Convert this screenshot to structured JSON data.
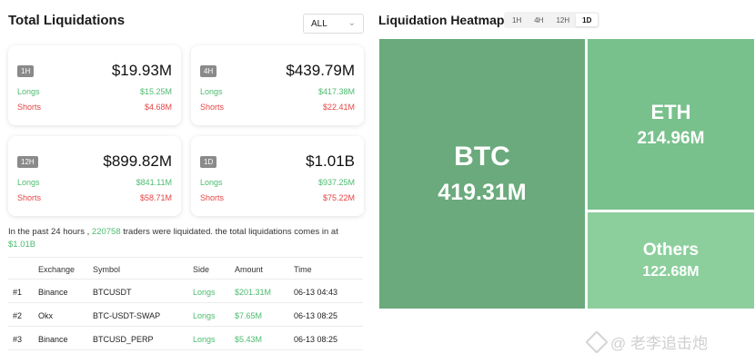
{
  "total": {
    "title": "Total Liquidations",
    "filter": "ALL",
    "cards": [
      {
        "badge": "1H",
        "total": "$19.93M",
        "longs_label": "Longs",
        "longs": "$15.25M",
        "shorts_label": "Shorts",
        "shorts": "$4.68M"
      },
      {
        "badge": "4H",
        "total": "$439.79M",
        "longs_label": "Longs",
        "longs": "$417.38M",
        "shorts_label": "Shorts",
        "shorts": "$22.41M"
      },
      {
        "badge": "12H",
        "total": "$899.82M",
        "longs_label": "Longs",
        "longs": "$841.11M",
        "shorts_label": "Shorts",
        "shorts": "$58.71M"
      },
      {
        "badge": "1D",
        "total": "$1.01B",
        "longs_label": "Longs",
        "longs": "$937.25M",
        "shorts_label": "Shorts",
        "shorts": "$75.22M"
      }
    ],
    "summary": {
      "prefix": "In the past 24 hours ,",
      "traders": "220758",
      "middle": "traders were liquidated. the total liquidations comes in at",
      "amount": "$1.01B"
    }
  },
  "table": {
    "headers": {
      "exchange": "Exchange",
      "symbol": "Symbol",
      "side": "Side",
      "amount": "Amount",
      "time": "Time"
    },
    "rows": [
      {
        "rank": "#1",
        "exchange": "Binance",
        "symbol": "BTCUSDT",
        "side": "Longs",
        "amount": "$201.31M",
        "time": "06-13 04:43"
      },
      {
        "rank": "#2",
        "exchange": "Okx",
        "symbol": "BTC-USDT-SWAP",
        "side": "Longs",
        "amount": "$7.65M",
        "time": "06-13 08:25"
      },
      {
        "rank": "#3",
        "exchange": "Binance",
        "symbol": "BTCUSD_PERP",
        "side": "Longs",
        "amount": "$5.43M",
        "time": "06-13 08:25"
      }
    ]
  },
  "heatmap": {
    "title": "Liquidation Heatmap",
    "tabs": [
      "1H",
      "4H",
      "12H",
      "1D"
    ],
    "active_tab": "1D",
    "tiles": [
      {
        "name": "BTC",
        "value": "419.31M"
      },
      {
        "name": "ETH",
        "value": "214.96M"
      },
      {
        "name": "Others",
        "value": "122.68M"
      }
    ]
  },
  "watermark": "@ 老李追击炮",
  "colors": {
    "long": "#4dbb6f",
    "short": "#e64545",
    "btc_tile": "#6aaa7c",
    "eth_tile": "#78c08c",
    "others_tile": "#8ccf9d"
  }
}
